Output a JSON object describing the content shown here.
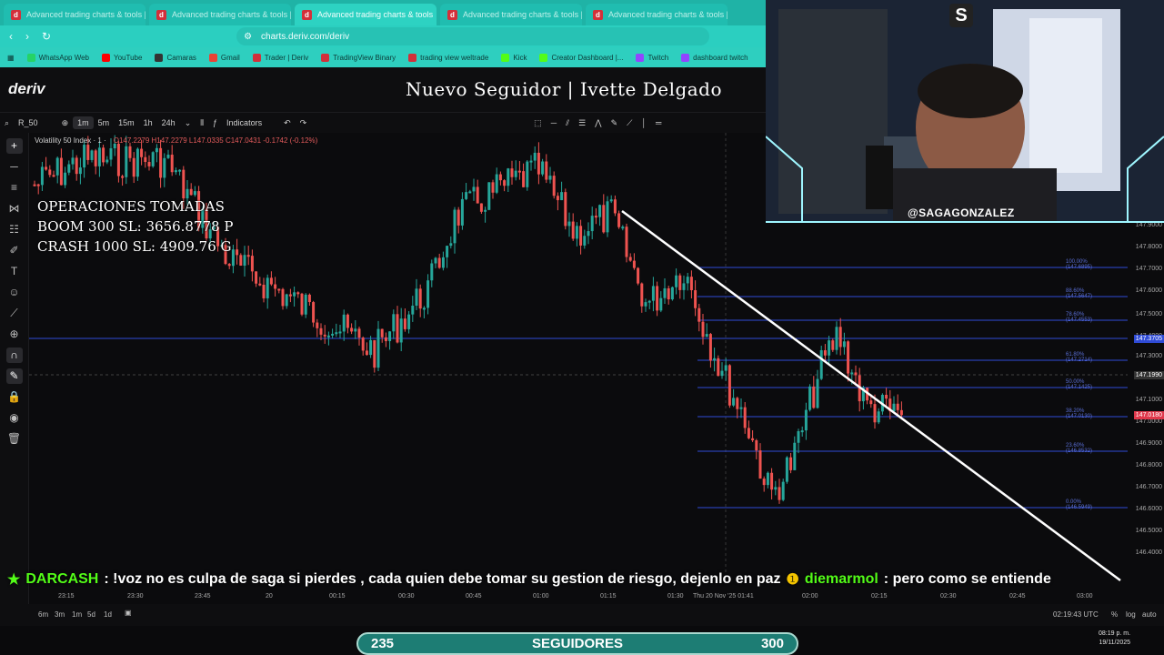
{
  "browser": {
    "tabs": [
      {
        "title": "Advanced trading charts & tools | D"
      },
      {
        "title": "Advanced trading charts & tools | D"
      },
      {
        "title": "Advanced trading charts & tools",
        "active": true
      },
      {
        "title": "Advanced trading charts & tools | D"
      },
      {
        "title": "Advanced trading charts & tools | D"
      }
    ],
    "url": "charts.deriv.com/deriv",
    "bookmarks": [
      {
        "label": "WhatsApp Web",
        "color": "#25d366"
      },
      {
        "label": "YouTube",
        "color": "#ff0000"
      },
      {
        "label": "Camaras",
        "color": "#333333"
      },
      {
        "label": "Gmail",
        "color": "#ea4335"
      },
      {
        "label": "Trader | Deriv",
        "color": "#d2303a"
      },
      {
        "label": "TradingView Binary",
        "color": "#d2303a"
      },
      {
        "label": "trading view weltrade",
        "color": "#d2303a"
      },
      {
        "label": "Kick",
        "color": "#53fc18"
      },
      {
        "label": "Creator Dashboard |...",
        "color": "#53fc18"
      },
      {
        "label": "Twitch",
        "color": "#9146ff"
      },
      {
        "label": "dashboard twitch",
        "color": "#9146ff"
      }
    ]
  },
  "app": {
    "logo": "deriv",
    "overlay_title": "Nuevo Seguidor | Ivette Delgado"
  },
  "toolbar": {
    "symbol": "R_50",
    "intervals": [
      "1m",
      "5m",
      "15m",
      "1h",
      "24h"
    ],
    "selected_interval": "1m",
    "indicators_label": "Indicators"
  },
  "legend": {
    "title": "Volatility 50 Index · 1 ·",
    "ohlc": "O147.2279 H147.2279 L147.0335 C147.0431 -0.1742 (-0.12%)"
  },
  "overlay_ops": {
    "line1": "OPERACIONES TOMADAS",
    "line2": "BOOM 300 SL: 3656.8778 P",
    "line3": "CRASH 1000 SL: 4909.76 G"
  },
  "price_axis": {
    "labels": [
      "147.9000",
      "147.8000",
      "147.7000",
      "147.6000",
      "147.5000",
      "147.4000",
      "147.3000",
      "147.1000",
      "147.0000",
      "146.9000",
      "146.8000",
      "146.7000",
      "146.6000",
      "146.5000",
      "146.4000"
    ],
    "current_price": "147.1990",
    "crosshair_badge": "147.3705",
    "last_price": "147.0180"
  },
  "fib_levels": [
    {
      "label": "100.00% (147.6895)"
    },
    {
      "label": "88.60% (147.5647)"
    },
    {
      "label": "78.60% (147.4553)"
    },
    {
      "label": "61.80% (147.2714)"
    },
    {
      "label": "50.00% (147.1425)"
    },
    {
      "label": "38.20% (147.0130)"
    },
    {
      "label": "23.60% (146.8532)"
    },
    {
      "label": "0.00% (146.5949)"
    }
  ],
  "time_axis": {
    "labels": [
      "23:15",
      "23:30",
      "23:45",
      "20",
      "00:15",
      "00:30",
      "00:45",
      "01:00",
      "01:15",
      "01:30",
      "Thu 20 Nov '25  01:41",
      "02:00",
      "02:15",
      "02:30",
      "02:45",
      "03:00"
    ]
  },
  "bottom": {
    "ranges": [
      "6m",
      "3m",
      "1m",
      "5d",
      "1d"
    ],
    "utc_time": "02:19:43 UTC",
    "percent": "%",
    "log": "log",
    "auto": "auto"
  },
  "ticker": {
    "user1": "DARCASH",
    "msg1": ": !voz no es culpa de saga si pierdes , cada quien debe tomar su gestion de riesgo, dejenlo en paz",
    "user2": "diemarmol",
    "msg2": ": pero como se entiende"
  },
  "follow_counter": {
    "current": "235",
    "label": "SEGUIDORES",
    "goal": "300"
  },
  "clock": {
    "time": "08:19 p. m.",
    "date": "19/11/2025"
  },
  "webcam": {
    "handle": "@SAGAGONZALEZ",
    "logo_letter": "S"
  },
  "colors": {
    "bull": "#26a69a",
    "bear": "#ef5350",
    "fib": "#2f4bd6",
    "trendline": "#ffffff",
    "accent": "#1fb3a6"
  }
}
